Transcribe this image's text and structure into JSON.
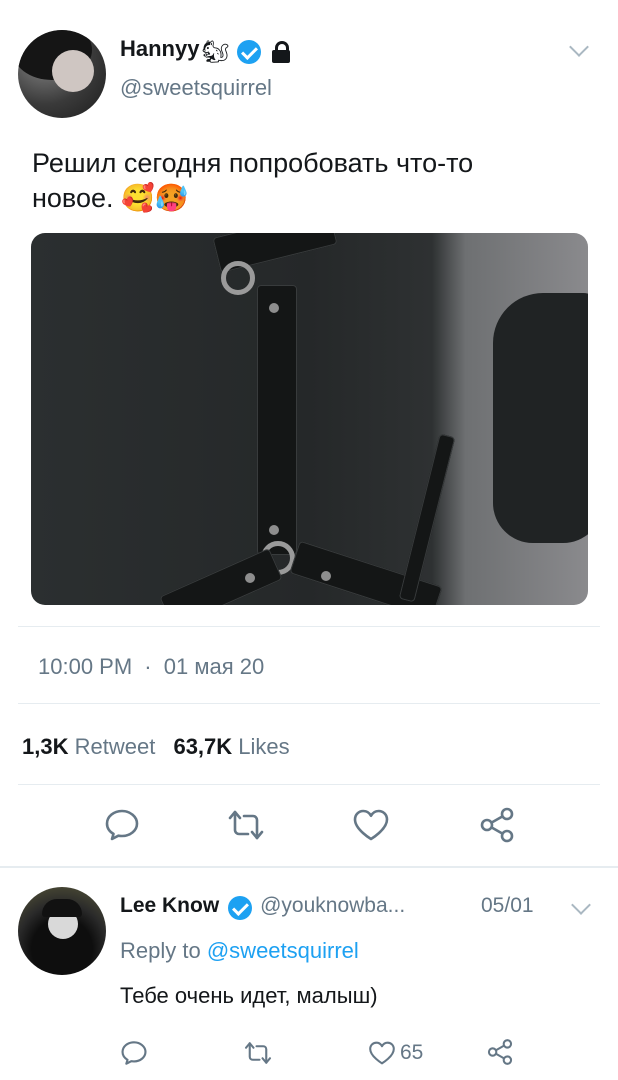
{
  "tweet": {
    "display_name": "Hannyy",
    "name_emoji": "🐿",
    "handle": "@sweetsquirrel",
    "text_line1": "Решил сегодня попробовать что-то",
    "text_line2": "новое.",
    "text_emojis": "🥰🥵",
    "time": "10:00 PM",
    "separator": "·",
    "date": "01 мая 20",
    "retweets_count": "1,3K",
    "retweets_label": "Retweet",
    "likes_count": "63,7K",
    "likes_label": "Likes"
  },
  "reply": {
    "display_name": "Lee Know",
    "handle": "@youknowba...",
    "date": "05/01",
    "reply_to_prefix": "Reply to",
    "reply_to_handle": "@sweetsquirrel",
    "text": "Тебе очень идет, малыш)",
    "likes_count": "65"
  },
  "colors": {
    "accent": "#1da1f2",
    "secondary_text": "#657786",
    "icon_gray": "#657786",
    "divider": "#e6ecf0"
  },
  "icons": [
    "verified-icon",
    "lock-icon",
    "chevron-down-icon",
    "reply-icon",
    "retweet-icon",
    "like-icon",
    "share-icon"
  ]
}
